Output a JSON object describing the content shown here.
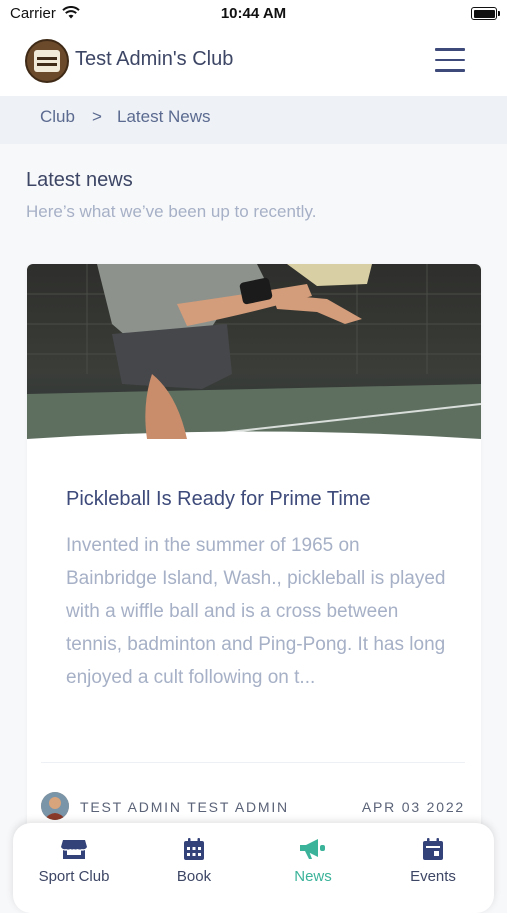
{
  "status_bar": {
    "carrier": "Carrier",
    "time": "10:44 AM"
  },
  "header": {
    "club_name": "Test Admin's Club",
    "logo_icon": "club-logo",
    "menu_icon": "hamburger-menu-icon"
  },
  "breadcrumb": {
    "items": [
      "Club",
      "Latest News"
    ],
    "separator": ">"
  },
  "section": {
    "title": "Latest news",
    "subtitle": "Here’s what we’ve been up to recently."
  },
  "article": {
    "title": "Pickleball Is Ready for Prime Time",
    "excerpt": "Invented in the summer of 1965 on Bainbridge Island, Wash., pickleball is played with a wiffle ball and is a cross between tennis, badminton and Ping-Pong. It has long enjoyed a cult following on t...",
    "author": "TEST ADMIN TEST ADMIN",
    "date": "APR 03 2022"
  },
  "tabs": [
    {
      "label": "Sport Club",
      "icon": "store-icon",
      "active": false
    },
    {
      "label": "Book",
      "icon": "calendar-icon",
      "active": false
    },
    {
      "label": "News",
      "icon": "megaphone-icon",
      "active": true
    },
    {
      "label": "Events",
      "icon": "calendar-event-icon",
      "active": false
    }
  ],
  "colors": {
    "accent": "#3bb39a",
    "text_primary": "#3d4665",
    "text_muted": "#a6b0c6",
    "breadcrumb_bg": "#eef1f5"
  }
}
